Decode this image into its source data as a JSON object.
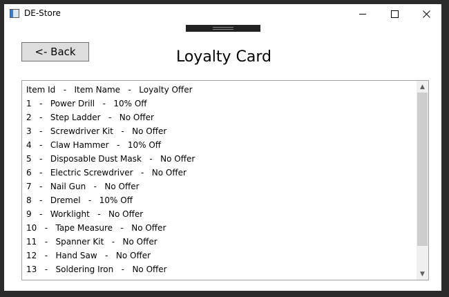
{
  "window": {
    "title": "DE-Store"
  },
  "controls": {
    "back_label": "<- Back"
  },
  "page": {
    "title": "Loyalty Card"
  },
  "list": {
    "header": "Item Id   -   Item Name   -   Loyalty Offer",
    "rows": [
      "1   -   Power Drill   -   10% Off",
      "2   -   Step Ladder   -   No Offer",
      "3   -   Screwdriver Kit   -   No Offer",
      "4   -   Claw Hammer   -   10% Off",
      "5   -   Disposable Dust Mask   -   No Offer",
      "6   -   Electric Screwdriver   -   No Offer",
      "7   -   Nail Gun   -   No Offer",
      "8   -   Dremel   -   10% Off",
      "9   -   Worklight   -   No Offer",
      "10   -   Tape Measure   -   No Offer",
      "11   -   Spanner Kit   -   No Offer",
      "12   -   Hand Saw   -   No Offer",
      "13   -   Soldering Iron   -   No Offer"
    ]
  },
  "icons": {
    "app": "app-icon",
    "minimize": "minimize-icon",
    "maximize": "maximize-icon",
    "close": "close-icon",
    "scroll_up": "scroll-up-arrow-icon",
    "scroll_down": "scroll-down-arrow-icon"
  }
}
